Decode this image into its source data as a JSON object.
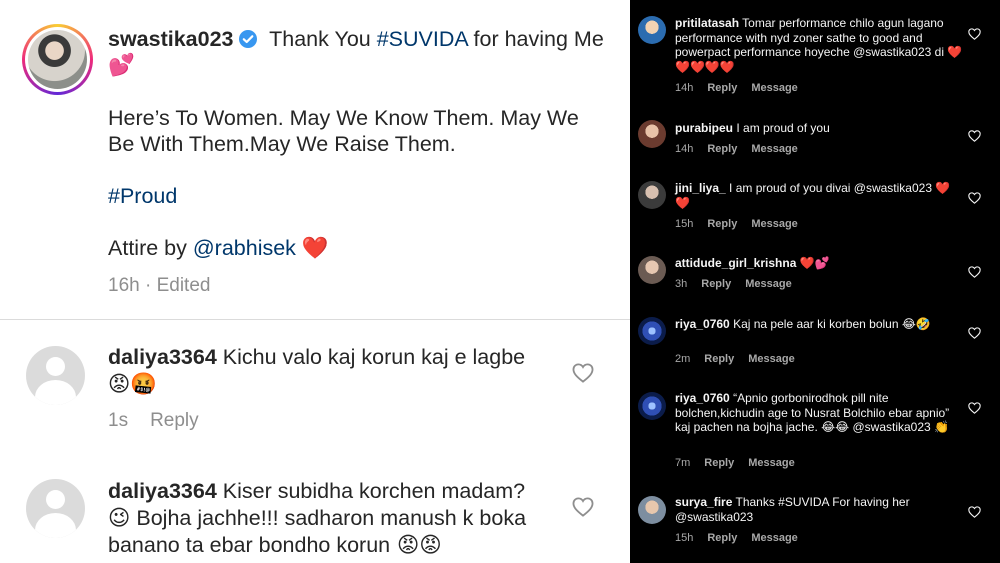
{
  "post": {
    "username": "swastika023",
    "caption_line1": "Thank You ",
    "caption_tag": "#SUVIDA",
    "caption_line1_end": " for having Me",
    "caption_emoji": "💕",
    "paragraph": "Here’s To Women. May We Know Them. May We Be With Them.May We Raise Them.",
    "hashtag": "#Proud",
    "attire_prefix": "Attire by ",
    "attire_mention": "@rabhisek",
    "attire_emoji": "❤️",
    "time": "16h",
    "edited": " · Edited"
  },
  "left_comments": [
    {
      "username": "daliya3364",
      "text": " Kichu valo kaj korun kaj e lagbe",
      "emoji": "😡🤬",
      "time": "1s",
      "reply": "Reply"
    },
    {
      "username": "daliya3364",
      "text": " Kiser subidha korchen madam?",
      "line2": "😉 Bojha jachhe!!! sadharon manush k boka banano ta ebar bondho korun",
      "emoji": " 😡😡"
    }
  ],
  "right_comments": [
    {
      "username": "pritilatasah",
      "text": " Tomar performance chilo agun lagano performance with nyd zoner sathe to good  and powerpact performance hoyeche @swastika023  di ",
      "emoji": "❤️❤️❤️❤️❤️",
      "time": "14h",
      "reply": "Reply",
      "message": "Message",
      "avatar_color": "#2b6cb0"
    },
    {
      "username": "purabipeu",
      "text": " I am proud of you",
      "emoji": "",
      "time": "14h",
      "reply": "Reply",
      "message": "Message",
      "avatar_color": "#c89a8a"
    },
    {
      "username": "jini_liya_",
      "text": " I am proud of you divai @swastika023 ",
      "emoji": "❤️❤️",
      "time": "15h",
      "reply": "Reply",
      "message": "Message",
      "avatar_color": "#5a5a5a"
    },
    {
      "username": "attidude_girl_krishna",
      "text": " ",
      "emoji": "❤️💕",
      "time": "3h",
      "reply": "Reply",
      "message": "Message",
      "avatar_color": "#6b5b53"
    },
    {
      "username": "riya_0760",
      "text": " Kaj na pele aar ki korben bolun ",
      "emoji": "😂🤣",
      "time": "2m",
      "reply": "Reply",
      "message": "Message",
      "avatar_color": "#1e3a8a"
    },
    {
      "username": "riya_0760",
      "text": " “Apnio gorbonirodhok pill nite bolchen,kichudin age to Nusrat Bolchilo ebar apnio” kaj pachen na bojha jache. ",
      "emoji": "😂😂",
      "text2": " @swastika023 ",
      "emoji2": "👏",
      "time": "7m",
      "reply": "Reply",
      "message": "Message",
      "avatar_color": "#1e3a8a"
    },
    {
      "username": "surya_fire",
      "text": " Thanks #SUVIDA For having her @swastika023",
      "emoji": "",
      "time": "15h",
      "reply": "Reply",
      "message": "Message",
      "avatar_color": "#7d8ea0"
    }
  ]
}
